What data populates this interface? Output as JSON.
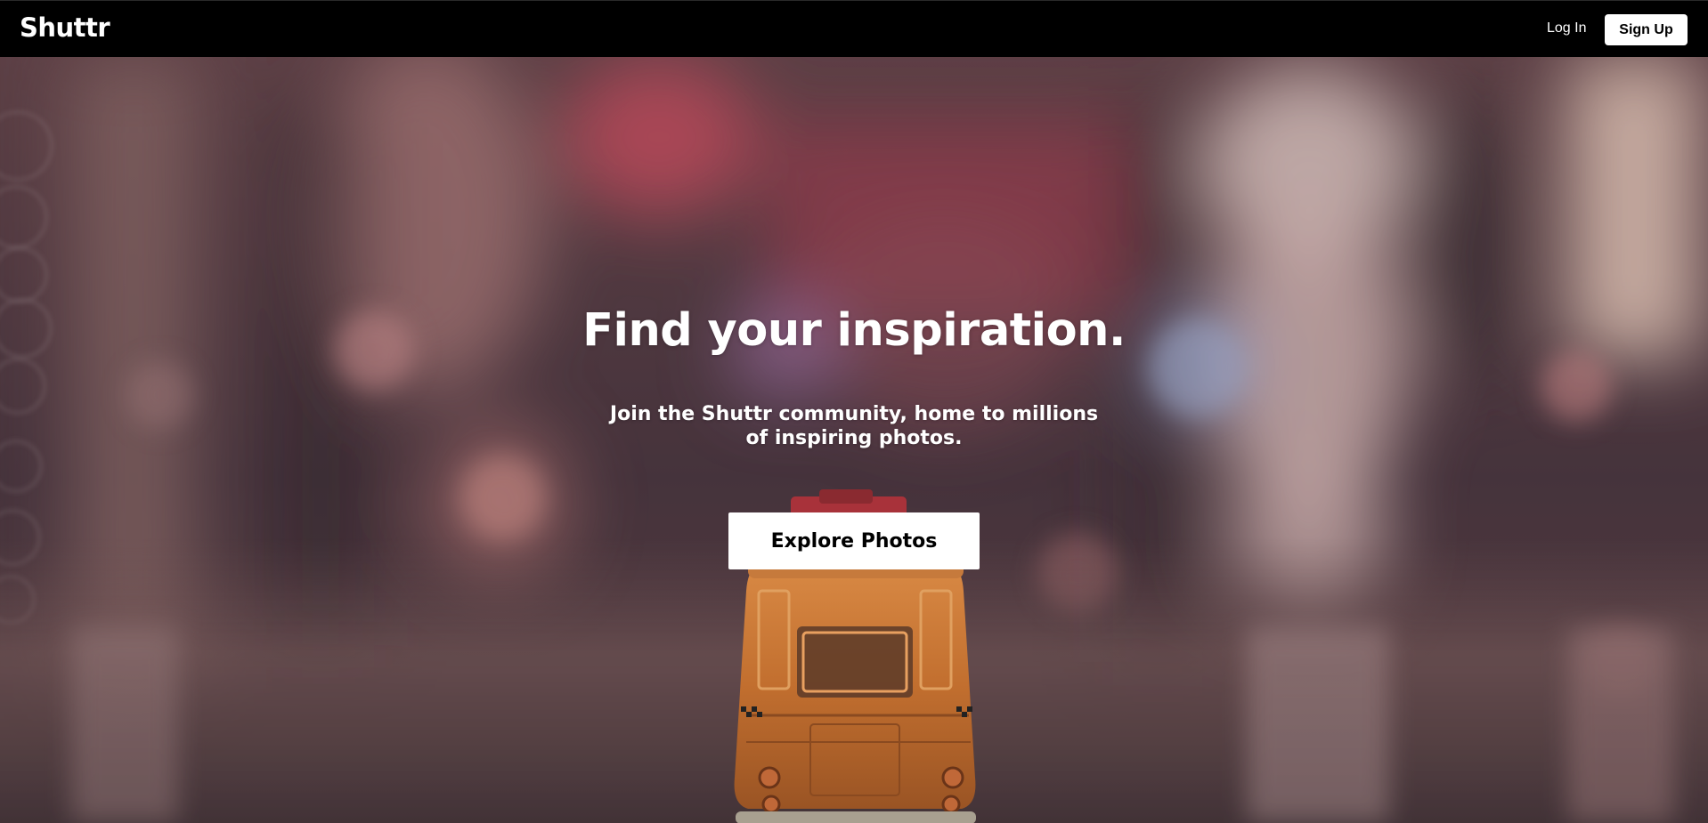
{
  "navbar": {
    "logo": "Shuttr",
    "login_label": "Log In",
    "signup_label": "Sign Up"
  },
  "hero": {
    "headline": "Find your inspiration.",
    "subheadline": "Join the Shuttr community, home to millions of inspiring photos.",
    "cta_label": "Explore Photos",
    "background_description_icon": "toy-bus-photo",
    "tint_color": "#5a3a42"
  }
}
